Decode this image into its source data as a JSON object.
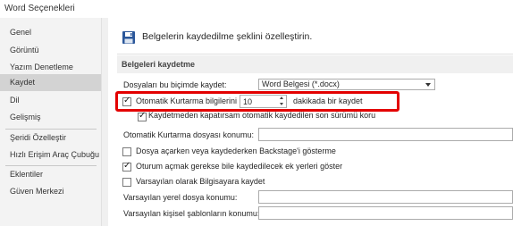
{
  "window": {
    "title": "Word Seçenekleri"
  },
  "sidebar": {
    "items": [
      {
        "label": "Genel"
      },
      {
        "label": "Görüntü"
      },
      {
        "label": "Yazım Denetleme"
      },
      {
        "label": "Kaydet"
      },
      {
        "label": "Dil"
      },
      {
        "label": "Gelişmiş"
      },
      {
        "label": "Şeridi Özelleştir"
      },
      {
        "label": "Hızlı Erişim Araç Çubuğu"
      },
      {
        "label": "Eklentiler"
      },
      {
        "label": "Güven Merkezi"
      }
    ],
    "selected": "Kaydet"
  },
  "header": {
    "text": "Belgelerin kaydedilme şeklini özelleştirin.",
    "icon": "floppy-disk-icon"
  },
  "section": {
    "title": "Belgeleri kaydetme"
  },
  "save_format": {
    "label": "Dosyaları bu biçimde kaydet:",
    "value": "Word Belgesi (*.docx)"
  },
  "autorecover": {
    "label": "Otomatik Kurtarma bilgilerini",
    "checked": true,
    "minutes": "10",
    "suffix": "dakikada bir kaydet"
  },
  "keep_last": {
    "label": "Kaydetmeden kapatırsam otomatik kaydedilen son sürümü koru",
    "checked": true
  },
  "autorecover_location": {
    "label": "Otomatik Kurtarma dosyası konumu:",
    "value": ""
  },
  "backstage": {
    "label": "Dosya açarken veya kaydederken Backstage'i gösterme",
    "checked": false
  },
  "show_places": {
    "label": "Oturum açmak gerekse bile kaydedilecek ek yerleri göster",
    "checked": true
  },
  "save_to_computer": {
    "label": "Varsayılan olarak Bilgisayara kaydet",
    "checked": false
  },
  "default_local": {
    "label": "Varsayılan yerel dosya konumu:",
    "value": ""
  },
  "personal_templates": {
    "label": "Varsayılan kişisel şablonların konumu:",
    "value": ""
  },
  "colors": {
    "highlight": "#e30000",
    "selected_nav": "#d3d3d3"
  }
}
